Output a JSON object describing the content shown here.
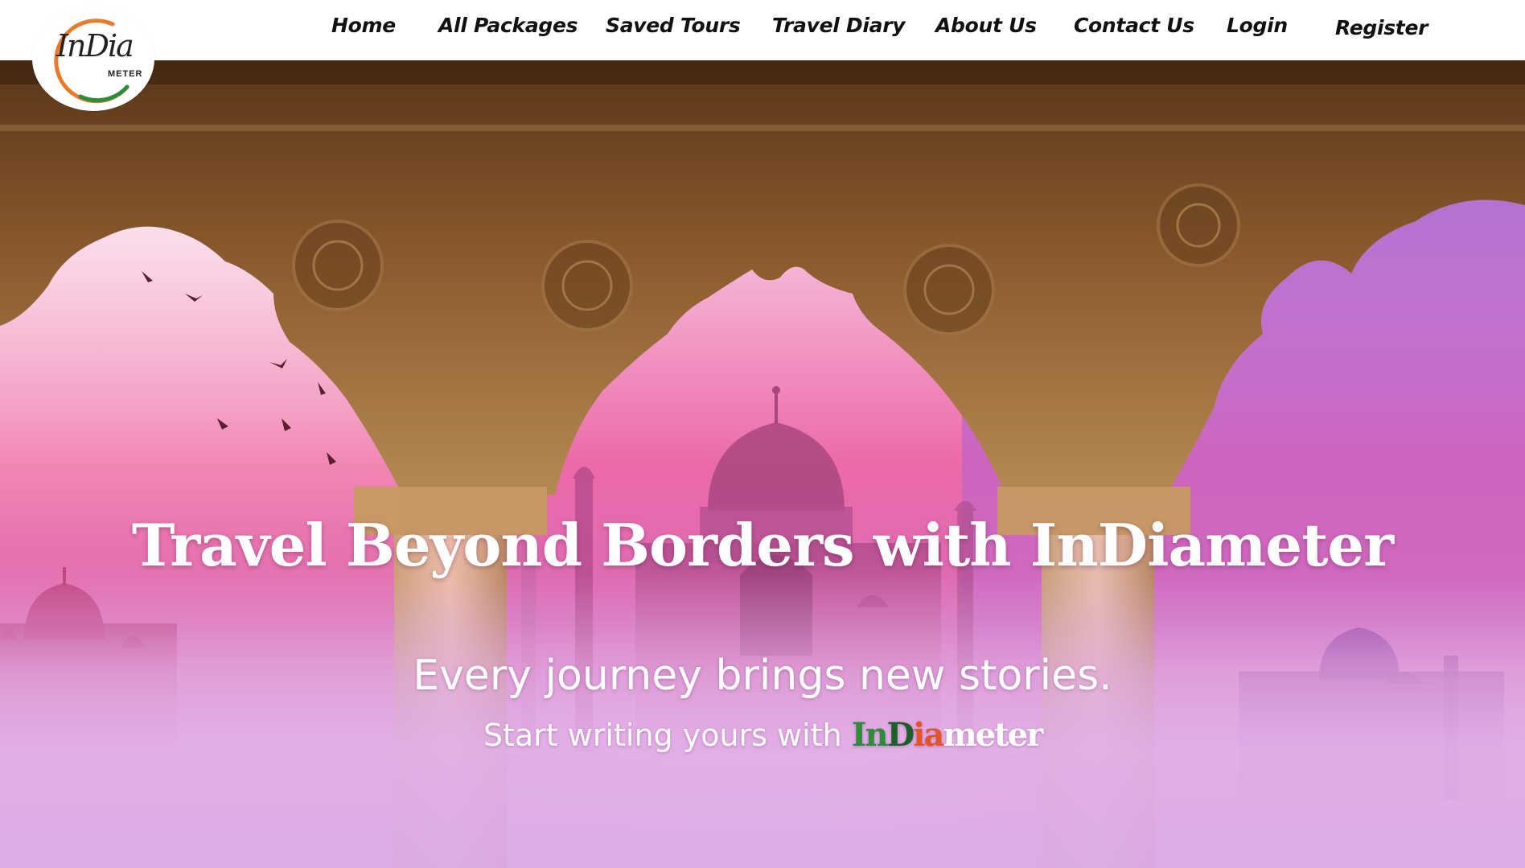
{
  "logo": {
    "script_text": "InDia",
    "sub_text": "METER",
    "colors": {
      "saffron": "#e87a2b",
      "green": "#2e8b3a"
    }
  },
  "nav": {
    "items": [
      {
        "label": "Home"
      },
      {
        "label": "All Packages"
      },
      {
        "label": "Saved Tours"
      },
      {
        "label": "Travel Diary"
      },
      {
        "label": "About Us"
      },
      {
        "label": "Contact Us"
      },
      {
        "label": "Login"
      },
      {
        "label": "Register"
      }
    ]
  },
  "hero": {
    "title": "Travel Beyond Borders with InDiameter",
    "tagline": "Every journey brings new stories.",
    "sub_prefix": "Start writing yours with",
    "brand": {
      "part1": "In",
      "part2": "D",
      "part3": "ia",
      "part4": "meter"
    },
    "background_icon": "taj-mahal-arches-illustration"
  },
  "theme": {
    "accent_pink": "#ec6aa8",
    "accent_purple": "#9a4fcf",
    "arch_stone": "#8a5a2e"
  }
}
